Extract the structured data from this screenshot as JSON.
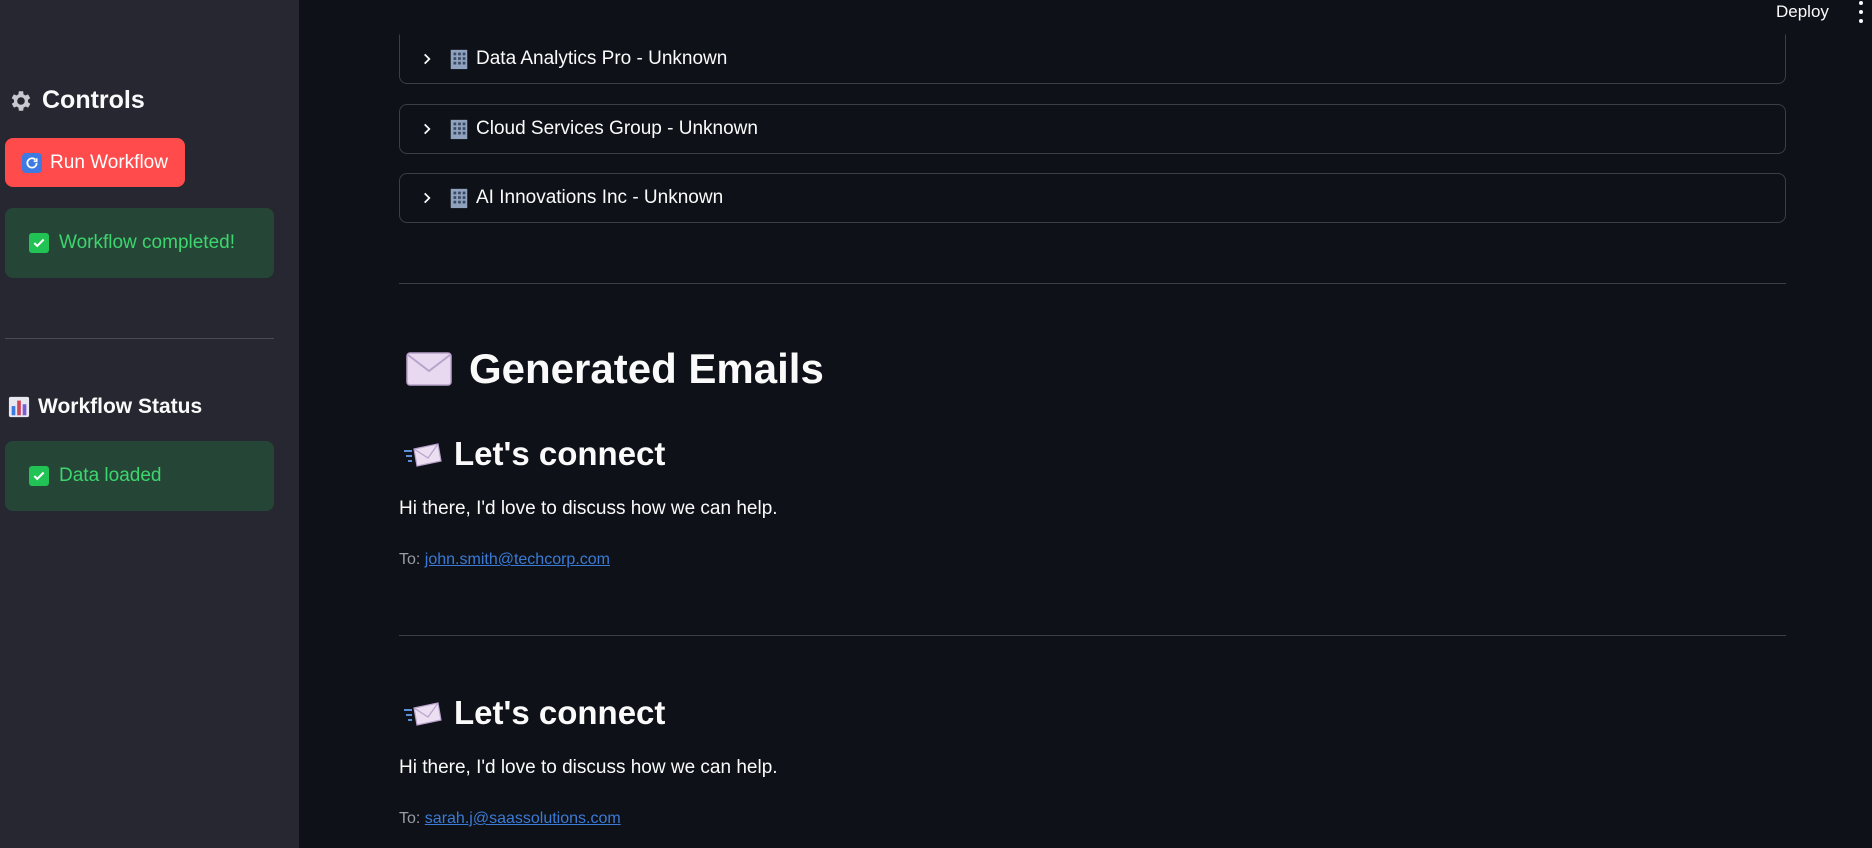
{
  "topbar": {
    "deploy_label": "Deploy",
    "menu_icon": "kebab-menu-icon"
  },
  "sidebar": {
    "controls_heading": "Controls",
    "run_button_label": "Run Workflow",
    "workflow_alert": "Workflow completed!",
    "status_heading": "Workflow Status",
    "status_alert": "Data loaded",
    "colors": {
      "primary": "#ff4b4b",
      "success_bg": "#21c354",
      "sidebar_bg": "#262730"
    }
  },
  "companies": [
    {
      "label": "Data Analytics Pro - Unknown"
    },
    {
      "label": "Cloud Services Group - Unknown"
    },
    {
      "label": "AI Innovations Inc - Unknown"
    }
  ],
  "emails_section": {
    "title": "Generated Emails",
    "emails": [
      {
        "subject": "Let's connect",
        "body": "Hi there, I'd love to discuss how we can help.",
        "to_prefix": "To:",
        "to": "john.smith@techcorp.com"
      },
      {
        "subject": "Let's connect",
        "body": "Hi there, I'd love to discuss how we can help.",
        "to_prefix": "To:",
        "to": "sarah.j@saassolutions.com"
      }
    ]
  }
}
